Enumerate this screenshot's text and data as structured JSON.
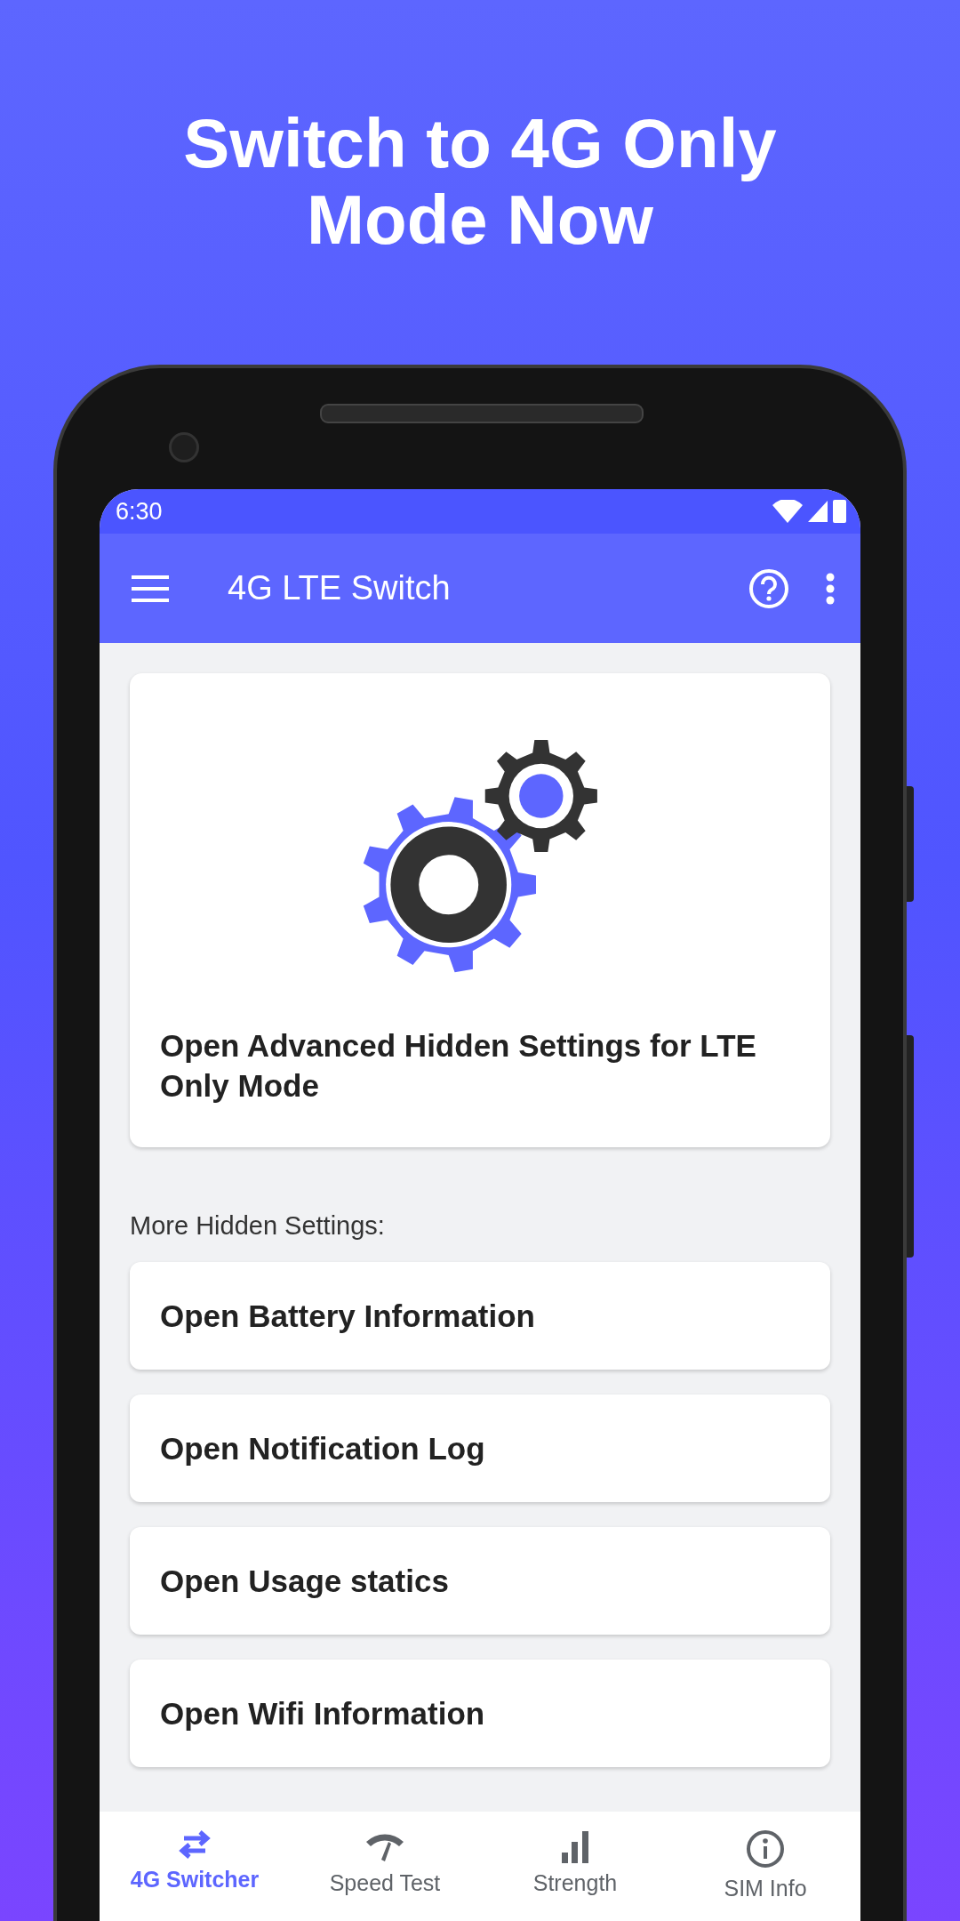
{
  "headline": "Switch to 4G Only Mode Now",
  "status_bar": {
    "time": "6:30"
  },
  "app_bar": {
    "title": "4G LTE Switch"
  },
  "main_card": {
    "title": "Open Advanced Hidden Settings for LTE Only Mode"
  },
  "section_label": "More Hidden Settings:",
  "settings": [
    {
      "label": "Open Battery Information"
    },
    {
      "label": "Open Notification Log"
    },
    {
      "label": "Open Usage statics"
    },
    {
      "label": "Open Wifi Information"
    }
  ],
  "bottom_nav": [
    {
      "label": "4G Switcher",
      "kind": "swap",
      "selected": true
    },
    {
      "label": "Speed Test",
      "kind": "gauge",
      "selected": false
    },
    {
      "label": "Strength",
      "kind": "bars",
      "selected": false
    },
    {
      "label": "SIM Info",
      "kind": "info",
      "selected": false
    }
  ]
}
